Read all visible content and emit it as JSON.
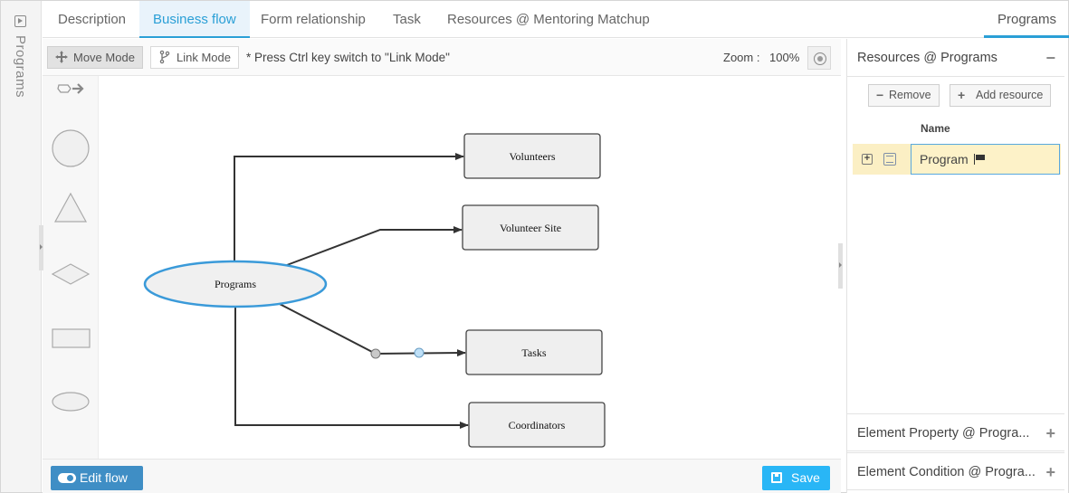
{
  "sidebar": {
    "title": "Programs",
    "icon": "play-square-icon"
  },
  "tabs": [
    {
      "label": "Description"
    },
    {
      "label": "Business flow",
      "active": true
    },
    {
      "label": "Form relationship"
    },
    {
      "label": "Task"
    },
    {
      "label": "Resources @ Mentoring Matchup"
    }
  ],
  "right_tab": {
    "label": "Programs",
    "active": true
  },
  "toolbar": {
    "move_mode_label": "Move Mode",
    "link_mode_label": "Link Mode",
    "hint": "* Press Ctrl key switch to \"Link Mode\"",
    "zoom_label": "Zoom :",
    "zoom_value": "100%"
  },
  "palette": {
    "tools": [
      "pointer-arrow",
      "circle",
      "triangle",
      "diamond",
      "rectangle",
      "ellipse"
    ]
  },
  "diagram": {
    "nodes": {
      "programs": "Programs",
      "volunteers": "Volunteers",
      "volunteer_site": "Volunteer Site",
      "tasks": "Tasks",
      "coordinators": "Coordinators"
    }
  },
  "footer": {
    "edit_flow_label": "Edit flow",
    "save_label": "Save"
  },
  "panel": {
    "resources_title": "Resources @ Programs",
    "remove_label": "Remove",
    "add_resource_label": "Add resource",
    "column_name": "Name",
    "rows": [
      {
        "name": "Program"
      }
    ],
    "element_property_title": "Element Property @ Progra...",
    "element_condition_title": "Element Condition @ Progra..."
  },
  "colors": {
    "accent": "#2a9fd6",
    "edit_flow": "#3f8ec5",
    "save": "#29b6f6",
    "selected_row": "#fbefc4",
    "node_select": "#3a9ad9"
  }
}
